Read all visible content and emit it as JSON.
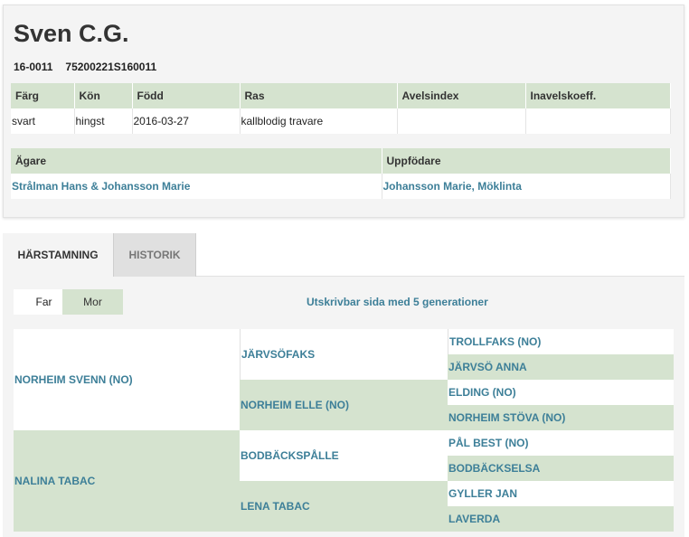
{
  "horse": {
    "name": "Sven C.G.",
    "reg_number": "16-0011",
    "ueln": "75200221S160011"
  },
  "info_table": {
    "headers": [
      "Färg",
      "Kön",
      "Född",
      "Ras",
      "Avelsindex",
      "Inavelskoeff."
    ],
    "values": [
      "svart",
      "hingst",
      "2016-03-27",
      "kallblodig travare",
      "",
      ""
    ]
  },
  "owner_table": {
    "headers": [
      "Ägare",
      "Uppfödare"
    ],
    "values": [
      "Strålman Hans & Johansson Marie",
      "Johansson Marie, Möklinta"
    ]
  },
  "tabs": [
    {
      "label": "HÄRSTAMNING",
      "active": true
    },
    {
      "label": "HISTORIK",
      "active": false
    }
  ],
  "toggles": {
    "far": "Far",
    "mor": "Mor"
  },
  "print_link": "Utskrivbar sida med 5 generationer",
  "pedigree": {
    "gen1": [
      "NORHEIM SVENN (NO)",
      "NALINA TABAC"
    ],
    "gen2": [
      "JÄRVSÖFAKS",
      "NORHEIM ELLE (NO)",
      "BODBÄCKSPÅLLE",
      "LENA TABAC"
    ],
    "gen3": [
      "TROLLFAKS (NO)",
      "JÄRVSÖ ANNA",
      "ELDING (NO)",
      "NORHEIM STÖVA (NO)",
      "PÅL BEST (NO)",
      "BODBÄCKSELSA",
      "GYLLER JAN",
      "LAVERDA"
    ]
  },
  "colors": {
    "accent_text": "#3d7f98",
    "green_cell": "#d5e3cf",
    "panel_bg": "#f4f4f4"
  }
}
